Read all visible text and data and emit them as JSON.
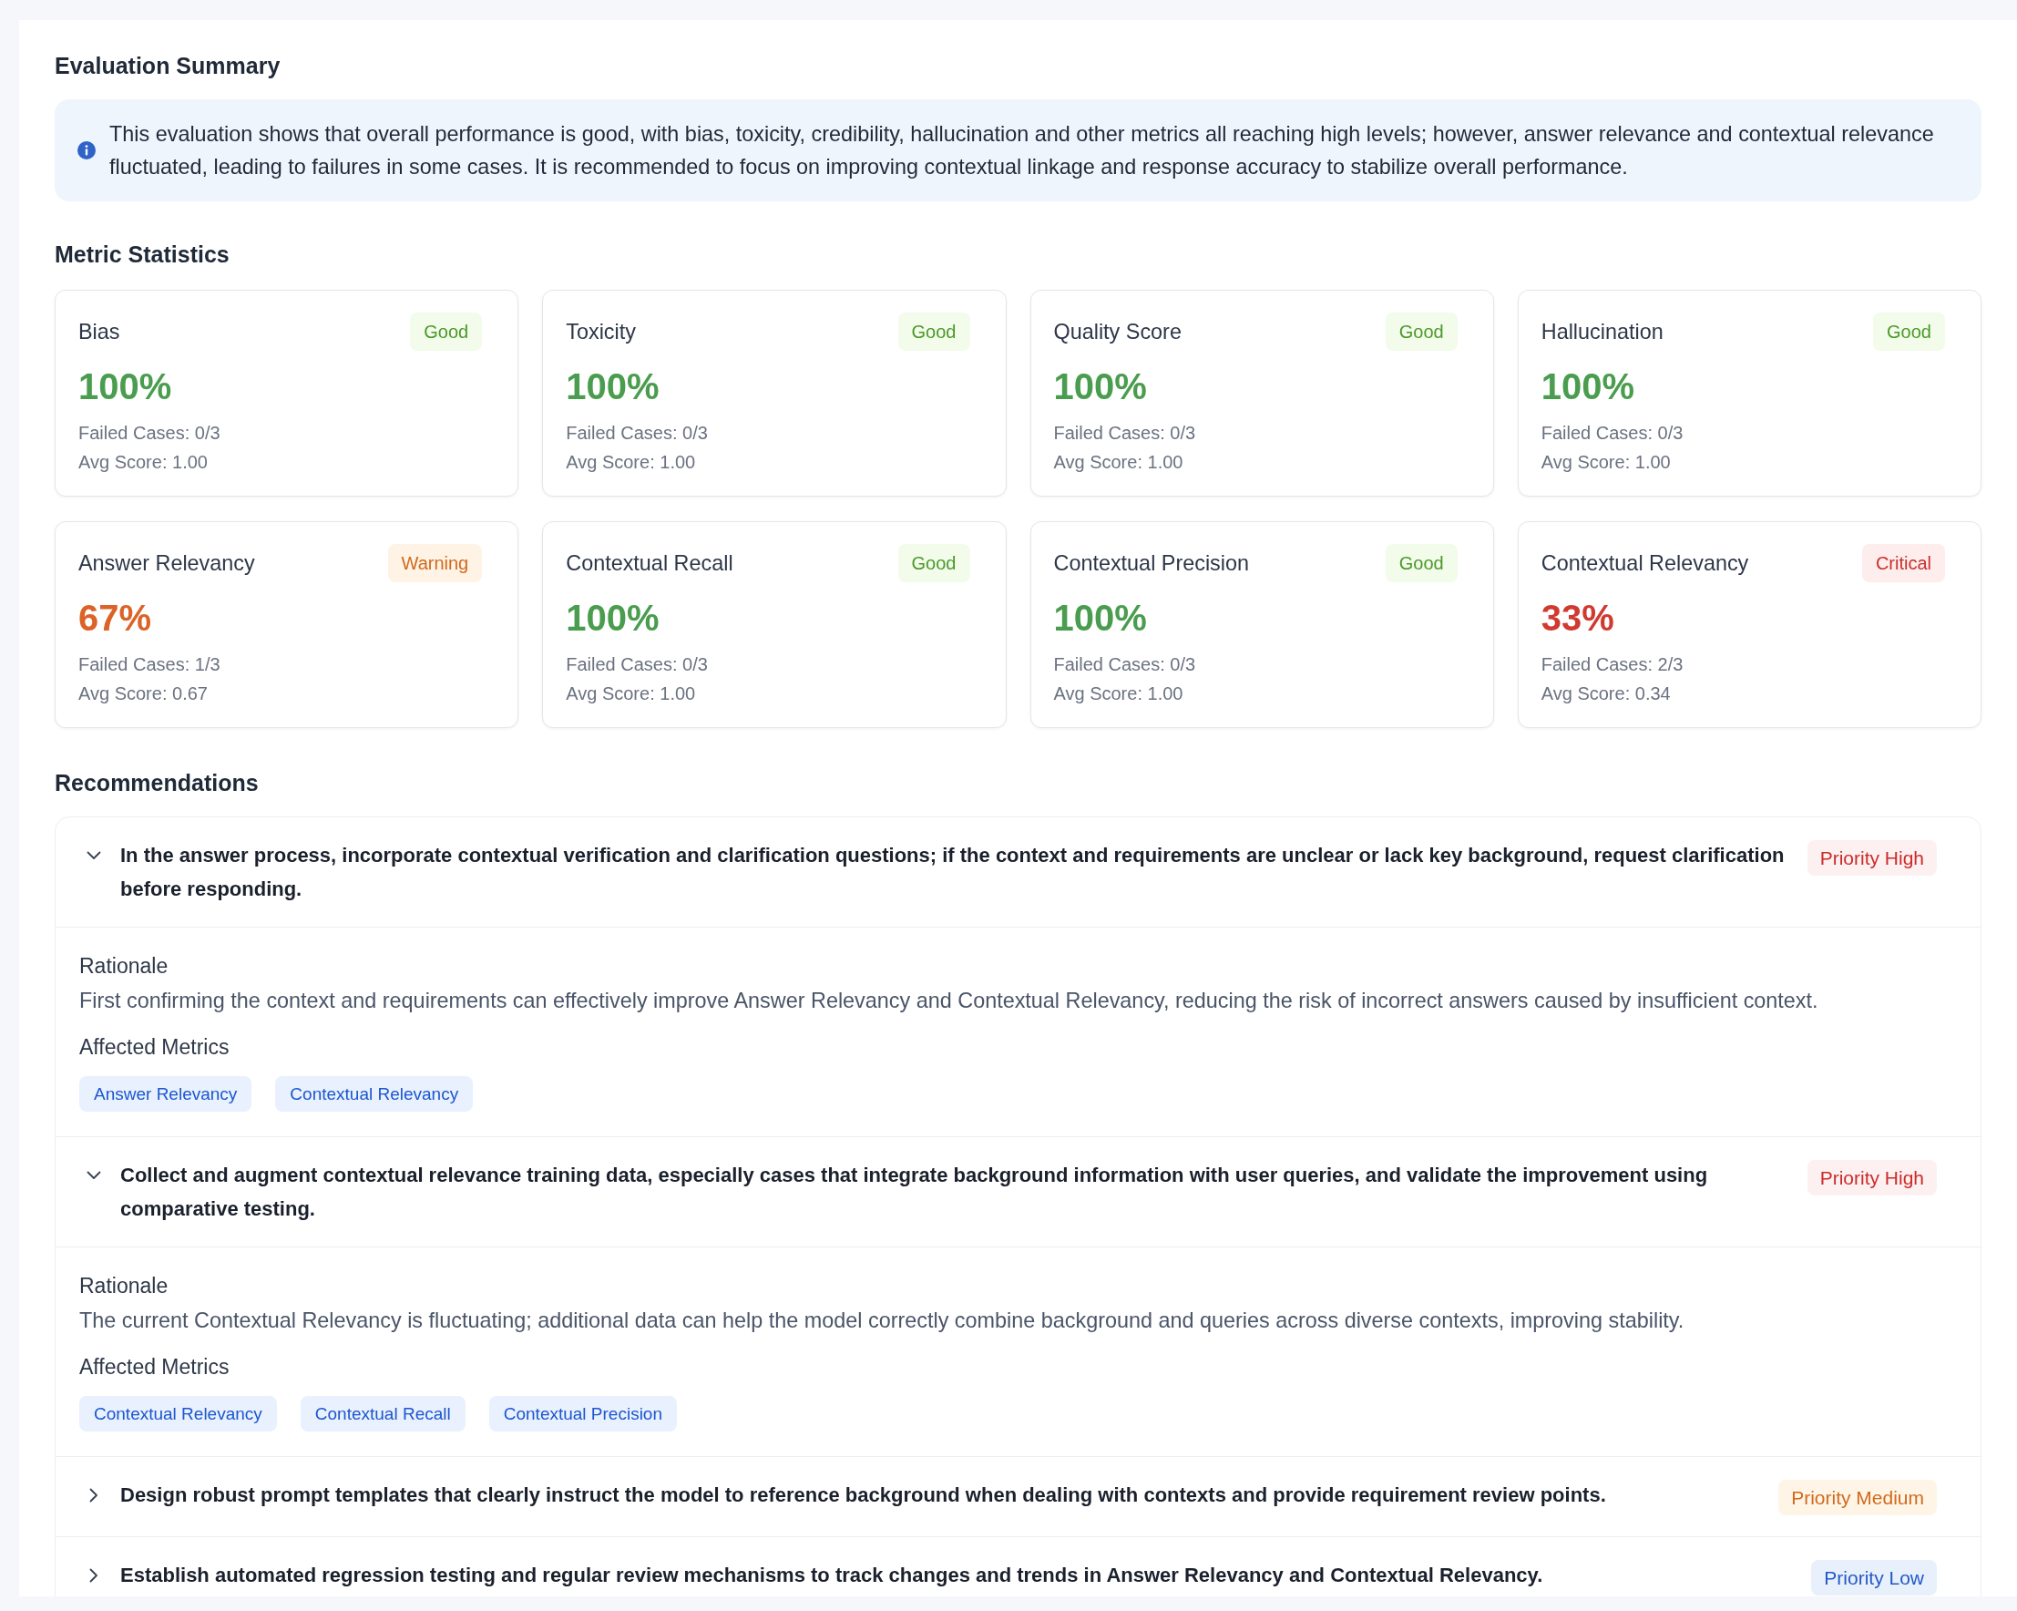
{
  "summary": {
    "title": "Evaluation Summary",
    "text": "This evaluation shows that overall performance is good, with bias, toxicity, credibility, hallucination and other metrics all reaching high levels; however, answer relevance and contextual relevance fluctuated, leading to failures in some cases. It is recommended to focus on improving contextual linkage and response accuracy to stabilize overall performance."
  },
  "metrics": {
    "title": "Metric Statistics",
    "cards": [
      {
        "name": "Bias",
        "kind": "good",
        "status_label": "Good",
        "value": "100%",
        "failed_cases": "Failed Cases: 0/3",
        "avg_score": "Avg Score: 1.00"
      },
      {
        "name": "Toxicity",
        "kind": "good",
        "status_label": "Good",
        "value": "100%",
        "failed_cases": "Failed Cases: 0/3",
        "avg_score": "Avg Score: 1.00"
      },
      {
        "name": "Quality Score",
        "kind": "good",
        "status_label": "Good",
        "value": "100%",
        "failed_cases": "Failed Cases: 0/3",
        "avg_score": "Avg Score: 1.00"
      },
      {
        "name": "Hallucination",
        "kind": "good",
        "status_label": "Good",
        "value": "100%",
        "failed_cases": "Failed Cases: 0/3",
        "avg_score": "Avg Score: 1.00"
      },
      {
        "name": "Answer Relevancy",
        "kind": "warning",
        "status_label": "Warning",
        "value": "67%",
        "failed_cases": "Failed Cases: 1/3",
        "avg_score": "Avg Score: 0.67"
      },
      {
        "name": "Contextual Recall",
        "kind": "good",
        "status_label": "Good",
        "value": "100%",
        "failed_cases": "Failed Cases: 0/3",
        "avg_score": "Avg Score: 1.00"
      },
      {
        "name": "Contextual Precision",
        "kind": "good",
        "status_label": "Good",
        "value": "100%",
        "failed_cases": "Failed Cases: 0/3",
        "avg_score": "Avg Score: 1.00"
      },
      {
        "name": "Contextual Relevancy",
        "kind": "critical",
        "status_label": "Critical",
        "value": "33%",
        "failed_cases": "Failed Cases: 2/3",
        "avg_score": "Avg Score: 0.34"
      }
    ]
  },
  "recommendations": {
    "title": "Recommendations",
    "items": [
      {
        "text": "In the answer process, incorporate contextual verification and clarification questions; if the context and requirements are unclear or lack key background, request clarification before responding.",
        "kind": "high",
        "priority_label": "Priority High",
        "expanded": true,
        "rationale_label": "Rationale",
        "rationale": "First confirming the context and requirements can effectively improve Answer Relevancy and Contextual Relevancy, reducing the risk of incorrect answers caused by insufficient context.",
        "affected_label": "Affected Metrics",
        "affected_metrics": [
          "Answer Relevancy",
          "Contextual Relevancy"
        ]
      },
      {
        "text": "Collect and augment contextual relevance training data, especially cases that integrate background information with user queries, and validate the improvement using comparative testing.",
        "kind": "high",
        "priority_label": "Priority High",
        "expanded": true,
        "rationale_label": "Rationale",
        "rationale": "The current Contextual Relevancy is fluctuating; additional data can help the model correctly combine background and queries across diverse contexts, improving stability.",
        "affected_label": "Affected Metrics",
        "affected_metrics": [
          "Contextual Relevancy",
          "Contextual Recall",
          "Contextual Precision"
        ]
      },
      {
        "text": "Design robust prompt templates that clearly instruct the model to reference background when dealing with contexts and provide requirement review points.",
        "kind": "medium",
        "priority_label": "Priority Medium",
        "expanded": false
      },
      {
        "text": "Establish automated regression testing and regular review mechanisms to track changes and trends in Answer Relevancy and Contextual Relevancy.",
        "kind": "low",
        "priority_label": "Priority Low",
        "expanded": false
      }
    ]
  }
}
